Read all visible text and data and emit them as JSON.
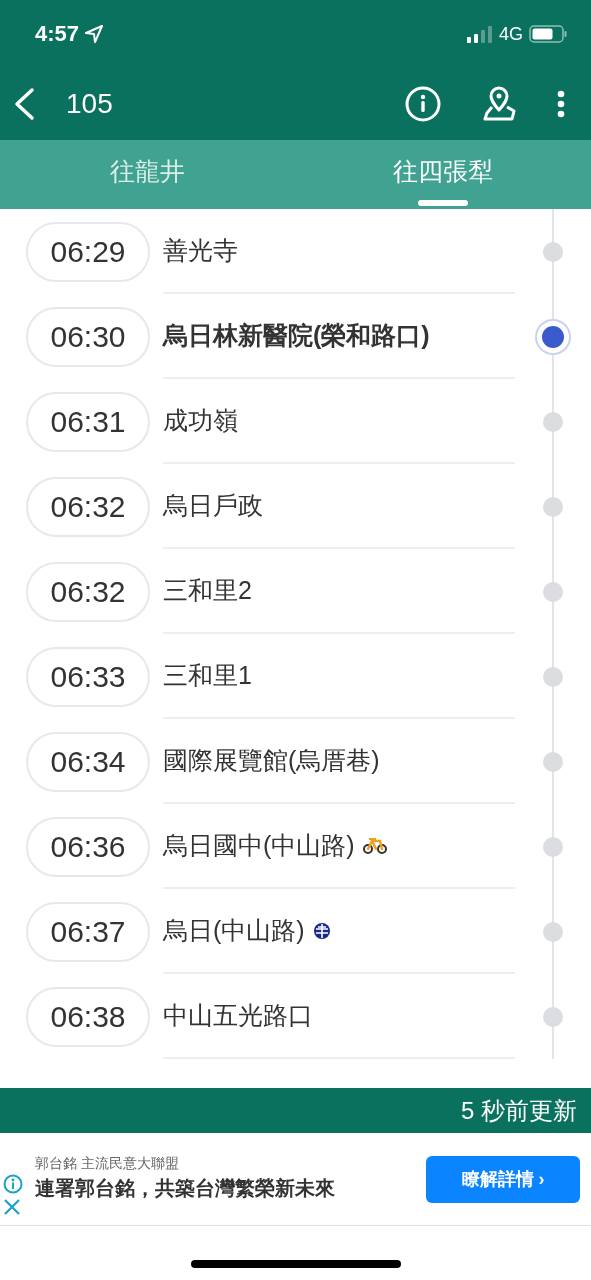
{
  "status_bar": {
    "time": "4:57",
    "network": "4G"
  },
  "header": {
    "title": "105"
  },
  "tabs": [
    {
      "label": "往龍井",
      "selected": false
    },
    {
      "label": "往四張犁",
      "selected": true
    }
  ],
  "stops": [
    {
      "time": "06:29",
      "name": "善光寺",
      "selected": false
    },
    {
      "time": "06:30",
      "name": "烏日林新醫院(榮和路口)",
      "selected": true
    },
    {
      "time": "06:31",
      "name": "成功嶺",
      "selected": false
    },
    {
      "time": "06:32",
      "name": "烏日戶政",
      "selected": false
    },
    {
      "time": "06:32",
      "name": "三和里2",
      "selected": false
    },
    {
      "time": "06:33",
      "name": "三和里1",
      "selected": false
    },
    {
      "time": "06:34",
      "name": "國際展覽館(烏厝巷)",
      "selected": false
    },
    {
      "time": "06:36",
      "name": "烏日國中(中山路)",
      "selected": false,
      "kind": "bike"
    },
    {
      "time": "06:37",
      "name": "烏日(中山路)",
      "selected": false,
      "kind": "rail"
    },
    {
      "time": "06:38",
      "name": "中山五光路口",
      "selected": false
    }
  ],
  "footer": {
    "updated": "5 秒前更新"
  },
  "ad": {
    "advertiser": "郭台銘 主流民意大聯盟",
    "headline": "連署郭台銘，共築台灣繁榮新未來",
    "button": "瞭解詳情 ›"
  }
}
